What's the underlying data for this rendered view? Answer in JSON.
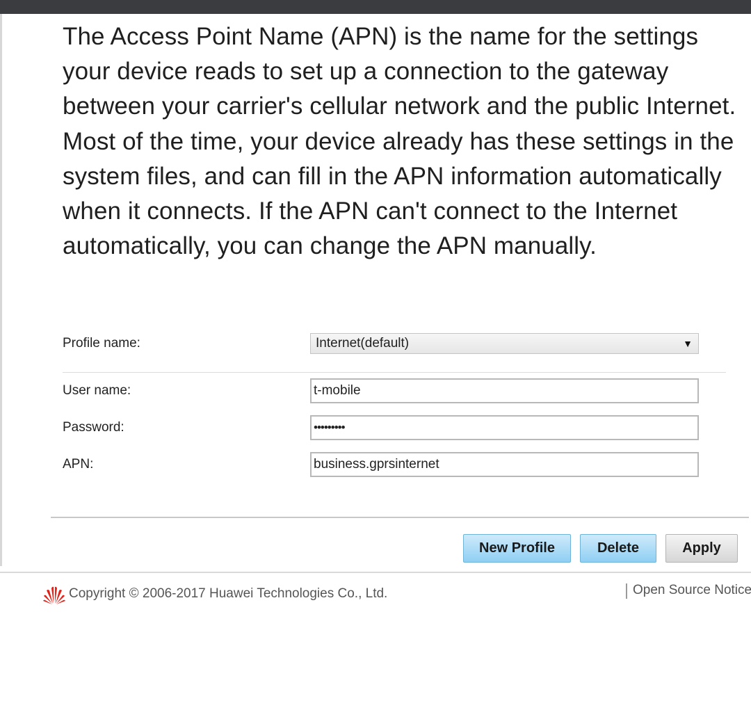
{
  "description": "The Access Point Name (APN) is the name for the settings your device reads to set up a connection to the gateway between your carrier's cellular network and the public Internet. Most of the time, your device already has these settings in the system files, and can fill in the APN information automatically when it connects. If the APN can't connect to the Internet automatically, you can change the APN manually.",
  "form": {
    "profile_name": {
      "label": "Profile name:",
      "value": "Internet(default)",
      "arrow": "▼"
    },
    "user_name": {
      "label": "User name:",
      "value": "t-mobile"
    },
    "password": {
      "label": "Password:",
      "value": "•••••••••"
    },
    "apn": {
      "label": "APN:",
      "value": "business.gprsinternet"
    }
  },
  "buttons": {
    "new_profile": "New Profile",
    "delete": "Delete",
    "apply": "Apply"
  },
  "footer": {
    "copyright": "Copyright © 2006-2017 Huawei Technologies Co., Ltd.",
    "open_source": "Open Source Notice",
    "logo_icon": "huawei-logo-icon"
  },
  "colors": {
    "topbar": "#3b3c40",
    "button_blue": "#8fcff3",
    "button_gray": "#d6d6d6",
    "logo_red": "#e2231a"
  }
}
